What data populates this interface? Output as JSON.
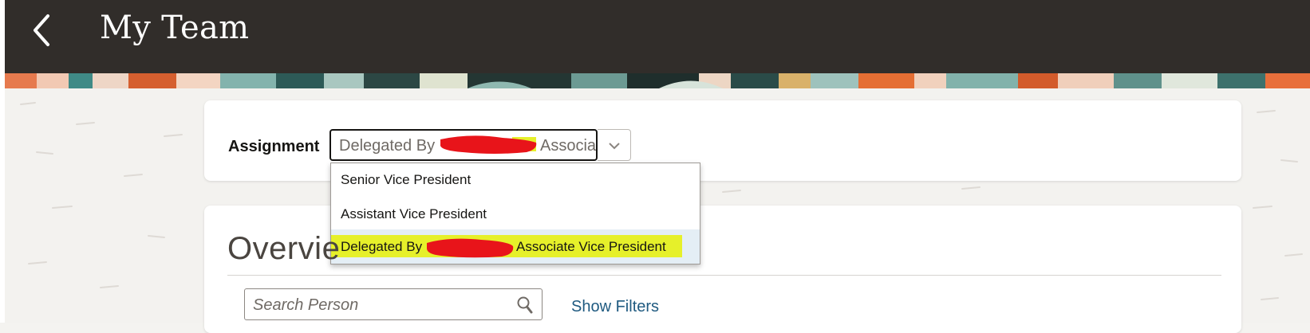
{
  "header": {
    "title": "My Team",
    "back_icon": "chevron-left-icon",
    "background_color": "#312d2a"
  },
  "assignment": {
    "label": "Assignment",
    "selected_value": "Delegated By ██████ Associa",
    "selected_prefix": "Delegated By",
    "selected_suffix": "Associa",
    "chevron_icon": "chevron-down-icon",
    "options": [
      {
        "label": "Senior Vice President"
      },
      {
        "label": "Assistant Vice President"
      },
      {
        "label_prefix": "Delegated By",
        "label_suffix": "Associate Vice President",
        "highlighted": true
      }
    ]
  },
  "overview": {
    "title": "Overvie",
    "search": {
      "placeholder": "Search Person",
      "value": "",
      "icon": "search-icon"
    },
    "show_filters_label": "Show Filters"
  },
  "colors": {
    "highlight_yellow": "#e6f02a",
    "redaction_red": "#e8141a",
    "link_blue": "#1f5a80",
    "selected_row_bg": "#e4eef5"
  }
}
